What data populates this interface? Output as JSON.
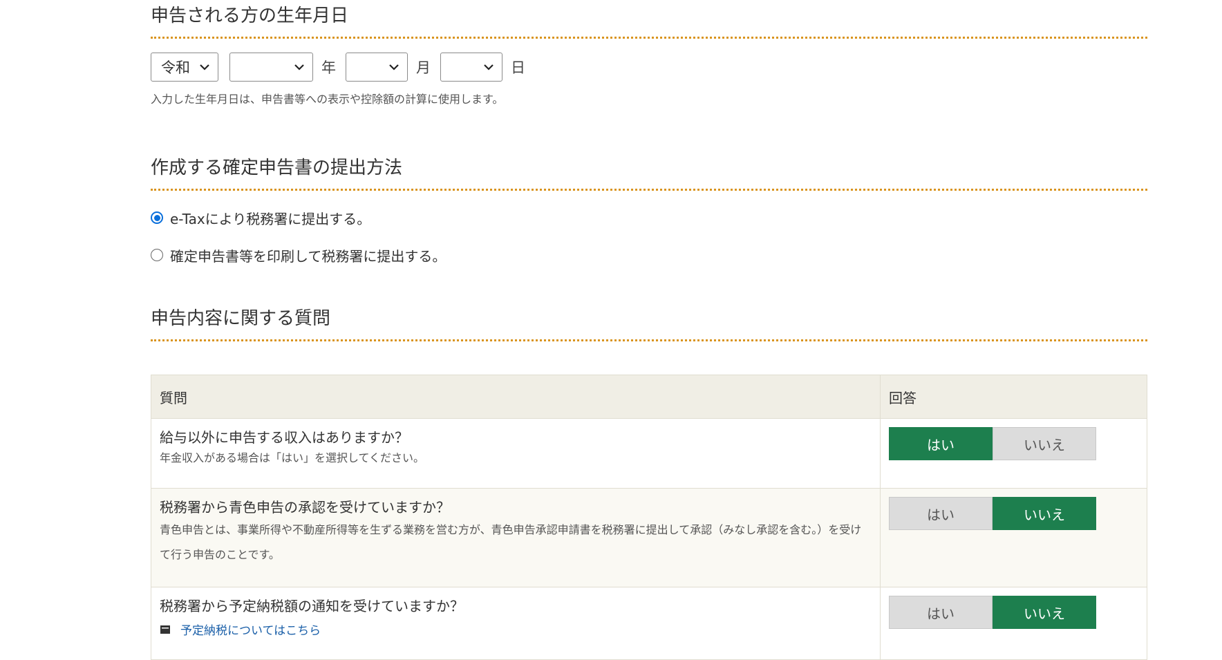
{
  "dob": {
    "title": "申告される方の生年月日",
    "era": "令和",
    "year": "",
    "year_unit": "年",
    "month": "",
    "month_unit": "月",
    "day": "",
    "day_unit": "日",
    "note": "入力した生年月日は、申告書等への表示や控除額の計算に使用します。"
  },
  "method": {
    "title": "作成する確定申告書の提出方法",
    "options": [
      {
        "label": "e-Taxにより税務署に提出する。",
        "checked": true
      },
      {
        "label": "確定申告書等を印刷して税務署に提出する。",
        "checked": false
      }
    ]
  },
  "questions": {
    "title": "申告内容に関する質問",
    "header_question": "質問",
    "header_answer": "回答",
    "yes_label": "はい",
    "no_label": "いいえ",
    "rows": [
      {
        "question": "給与以外に申告する収入はありますか？",
        "sub": "年金収入がある場合は「はい」を選択してください。",
        "answer": "yes"
      },
      {
        "question": "税務署から青色申告の承認を受けていますか？",
        "sub": "青色申告とは、事業所得や不動産所得等を生ずる業務を営む方が、青色申告承認申請書を税務署に提出して承認（みなし承認を含む。）を受けて行う申告のことです。",
        "answer": "no"
      },
      {
        "question": "税務署から予定納税額の通知を受けていますか？",
        "link": "予定納税についてはこちら",
        "answer": "no"
      }
    ]
  },
  "colors": {
    "accent_green": "#1d7f4e",
    "divider_orange": "#d9941e",
    "radio_blue": "#0a6fdb"
  }
}
